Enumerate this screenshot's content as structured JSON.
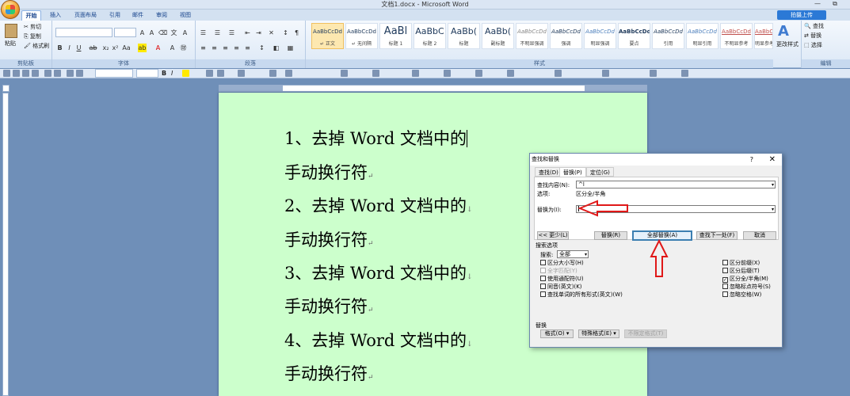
{
  "window": {
    "title": "文档1.docx - Microsoft Word",
    "minimize": "—",
    "restore": "⧉"
  },
  "tabs": [
    "开始",
    "插入",
    "页面布局",
    "引用",
    "邮件",
    "审阅",
    "视图"
  ],
  "share": "告诉我...",
  "share_label": "告诉我你想做什么",
  "share_btn": "拍摄上传",
  "ribbon": {
    "clipboard": {
      "label": "剪贴板",
      "paste": "粘贴",
      "cut": "剪切",
      "copy": "复制",
      "format_painter": "格式刷"
    },
    "font": {
      "label": "字体"
    },
    "paragraph": {
      "label": "段落"
    },
    "styles": {
      "label": "样式",
      "items": [
        {
          "sample": "AaBbCcDd",
          "name": "↵ 正文"
        },
        {
          "sample": "AaBbCcDd",
          "name": "↵ 无间隔"
        },
        {
          "sample": "AaBl",
          "name": "标题 1"
        },
        {
          "sample": "AaBbC",
          "name": "标题 2"
        },
        {
          "sample": "AaBb(",
          "name": "标题"
        },
        {
          "sample": "AaBb(",
          "name": "副标题"
        },
        {
          "sample": "AaBbCcDd",
          "name": "不明显强调"
        },
        {
          "sample": "AaBbCcDd",
          "name": "强调"
        },
        {
          "sample": "AaBbCcDd",
          "name": "明显强调"
        },
        {
          "sample": "AaBbCcDd",
          "name": "要点"
        },
        {
          "sample": "AaBbCcDd",
          "name": "引用"
        },
        {
          "sample": "AaBbCcDd",
          "name": "明显引用"
        },
        {
          "sample": "AaBbCcDd",
          "name": "不明显参考"
        },
        {
          "sample": "AaBbCcDd",
          "name": "明显参考"
        }
      ],
      "change": "更改样式"
    },
    "editing": {
      "label": "编辑",
      "find": "查找",
      "replace": "替换",
      "select": "选择"
    }
  },
  "document": {
    "lines": [
      "1、去掉 Word 文档中的",
      "手动换行符",
      "2、去掉 Word 文档中的",
      "手动换行符",
      "3、去掉 Word 文档中的",
      "手动换行符",
      "4、去掉 Word 文档中的",
      "手动换行符"
    ]
  },
  "dialog": {
    "title": "查找和替换",
    "help": "?",
    "close": "✕",
    "tabs": [
      "查找(D)",
      "替换(P)",
      "定位(G)"
    ],
    "find_label": "查找内容(N):",
    "find_value": "^l",
    "options_label": "选项:",
    "options_value": "区分全/半角",
    "replace_label": "替换为(I):",
    "replace_value": "",
    "buttons": {
      "less": "<< 更少(L)",
      "replace": "替换(R)",
      "replace_all": "全部替换(A)",
      "find_next": "查找下一处(F)",
      "cancel": "取消"
    },
    "search_options_label": "搜索选项",
    "search_label": "搜索:",
    "search_value": "全部",
    "left_checks": [
      {
        "label": "区分大小写(H)",
        "checked": false,
        "disabled": false
      },
      {
        "label": "全字匹配(Y)",
        "checked": false,
        "disabled": true
      },
      {
        "label": "使用通配符(U)",
        "checked": false,
        "disabled": false
      },
      {
        "label": "同音(英文)(K)",
        "checked": false,
        "disabled": false
      },
      {
        "label": "查找单词的所有形式(英文)(W)",
        "checked": false,
        "disabled": false
      }
    ],
    "right_checks": [
      {
        "label": "区分前缀(X)",
        "checked": false
      },
      {
        "label": "区分后缀(T)",
        "checked": false
      },
      {
        "label": "区分全/半角(M)",
        "checked": true
      },
      {
        "label": "忽略标点符号(S)",
        "checked": false
      },
      {
        "label": "忽略空格(W)",
        "checked": false
      }
    ],
    "replace_section": "替换",
    "format_btn": "格式(O) ▾",
    "special_btn": "特殊格式(E) ▾",
    "no_format_btn": "不限定格式(T)"
  },
  "colors": {
    "page": "#ccffcc",
    "arrow": "#e01818",
    "accent": "#2b79d6"
  }
}
